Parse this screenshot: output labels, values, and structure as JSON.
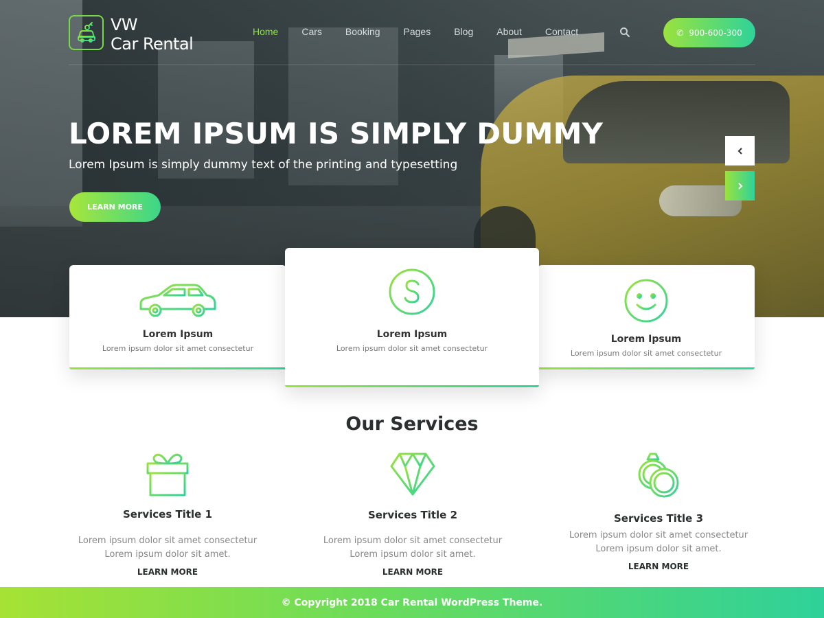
{
  "brand": {
    "line1": "VW",
    "line2": "Car Rental",
    "accent_start": "#9be23d",
    "accent_end": "#2ed39a"
  },
  "nav": {
    "items": [
      {
        "label": "Home",
        "active": true
      },
      {
        "label": "Cars",
        "active": false
      },
      {
        "label": "Booking",
        "active": false
      },
      {
        "label": "Pages",
        "active": false
      },
      {
        "label": "Blog",
        "active": false
      },
      {
        "label": "About",
        "active": false
      },
      {
        "label": "Contact",
        "active": false
      }
    ],
    "search_icon": "search-icon",
    "phone": "900-600-300",
    "phone_icon": "phone-icon"
  },
  "hero": {
    "title": "LOREM IPSUM IS SIMPLY DUMMY",
    "subtitle": "Lorem Ipsum is simply dummy text of the printing and typesetting",
    "button": "LEARN MORE",
    "prev_icon": "chevron-left-icon",
    "next_icon": "chevron-right-icon"
  },
  "features": [
    {
      "icon": "car-icon",
      "title": "Lorem Ipsum",
      "text": "Lorem ipsum dolor sit amet consectetur"
    },
    {
      "icon": "dollar-icon",
      "title": "Lorem Ipsum",
      "text": "Lorem ipsum dolor sit amet consectetur"
    },
    {
      "icon": "smiley-icon",
      "title": "Lorem Ipsum",
      "text": "Lorem ipsum dolor sit amet consectetur"
    }
  ],
  "services": {
    "heading": "Our Services",
    "items": [
      {
        "icon": "gift-icon",
        "title": "Services Title 1",
        "text": "Lorem ipsum dolor sit amet consectetur Lorem ipsum dolor sit amet.",
        "link": "LEARN MORE"
      },
      {
        "icon": "diamond-icon",
        "title": "Services Title 2",
        "text": "Lorem ipsum dolor sit amet consectetur Lorem ipsum dolor sit amet.",
        "link": "LEARN MORE"
      },
      {
        "icon": "rings-icon",
        "title": "Services Title 3",
        "text": "Lorem ipsum dolor sit amet consectetur Lorem ipsum dolor sit amet.",
        "link": "LEARN MORE"
      }
    ]
  },
  "footer": {
    "copyright": "© Copyright 2018 Car Rental WordPress Theme."
  }
}
